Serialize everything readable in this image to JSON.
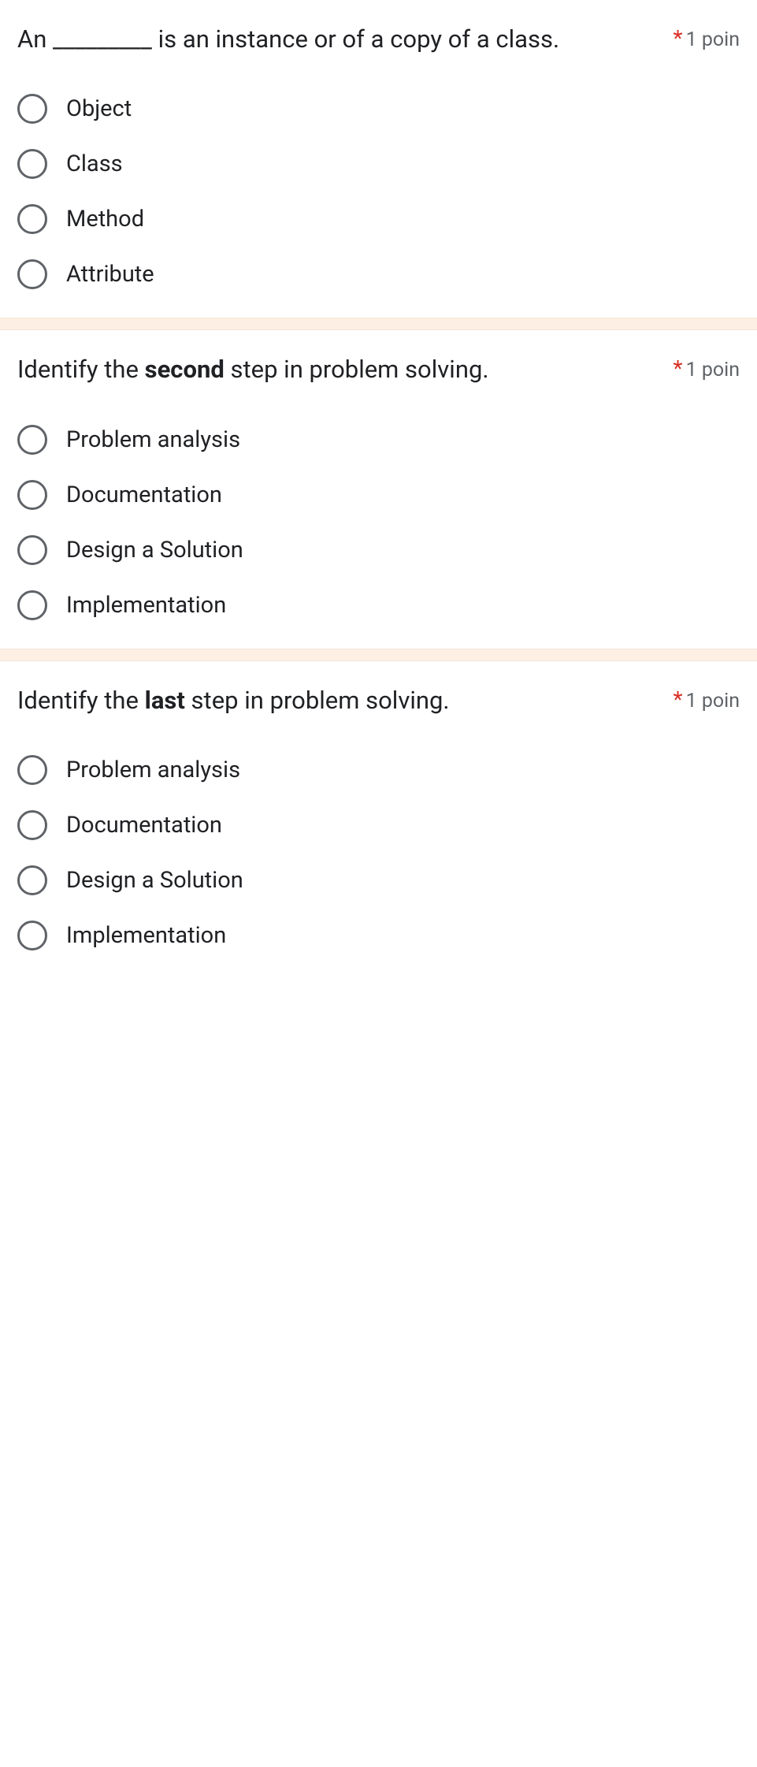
{
  "required_mark": "*",
  "points_label": "1 poin",
  "questions": [
    {
      "id": "q1",
      "prompt_parts": [
        {
          "text": "An _________ is an instance or of a copy of a class.",
          "bold": false
        }
      ],
      "options": [
        "Object",
        "Class",
        "Method",
        "Attribute"
      ]
    },
    {
      "id": "q2",
      "prompt_parts": [
        {
          "text": "Identify the ",
          "bold": false
        },
        {
          "text": "second",
          "bold": true
        },
        {
          "text": " step in problem solving.",
          "bold": false
        }
      ],
      "options": [
        "Problem analysis",
        "Documentation",
        "Design a Solution",
        "Implementation"
      ]
    },
    {
      "id": "q3",
      "prompt_parts": [
        {
          "text": "Identify the ",
          "bold": false
        },
        {
          "text": "last",
          "bold": true
        },
        {
          "text": " step in problem solving.",
          "bold": false
        }
      ],
      "options": [
        "Problem analysis",
        "Documentation",
        "Design a Solution",
        "Implementation"
      ]
    }
  ]
}
